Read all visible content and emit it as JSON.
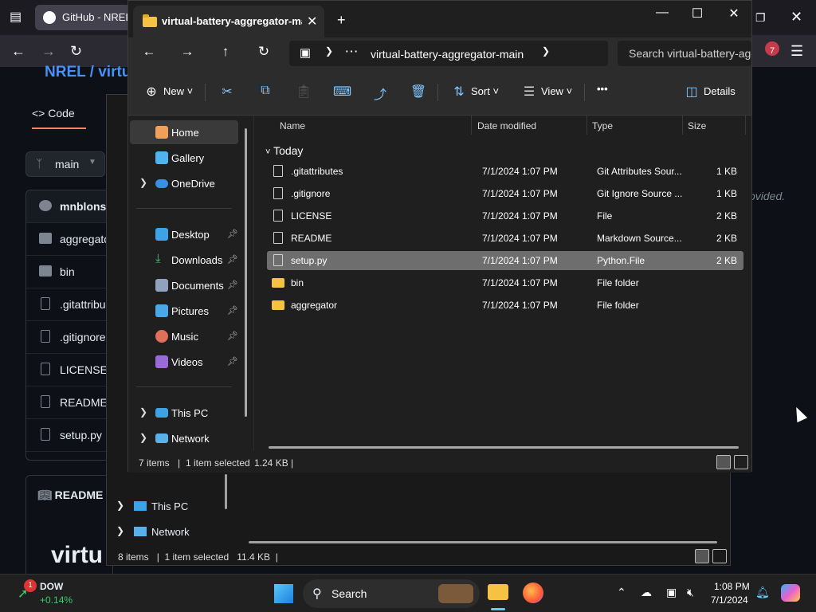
{
  "browser": {
    "tab_title": "GitHub - NREL/",
    "repo_owner": "NREL /",
    "repo_name": "virtu",
    "code_tab": "Code",
    "branch": "main",
    "files": [
      "mnblonsk",
      "aggregato",
      "bin",
      ".gitattribu",
      ".gitignore",
      "LICENSE",
      "README.",
      "setup.py"
    ],
    "readme_tab": "README",
    "readme_title": "virtu",
    "side_text": "ovided."
  },
  "explorer": {
    "tab_title": "virtual-battery-aggregator-main",
    "path": "virtual-battery-aggregator-main",
    "search_placeholder": "Search virtual-battery-aggregator-main",
    "toolbar": {
      "new_label": "New",
      "sort_label": "Sort",
      "view_label": "View",
      "more_label": "•••",
      "details_label": "Details"
    },
    "nav": {
      "home": "Home",
      "gallery": "Gallery",
      "onedrive": "OneDrive",
      "desktop": "Desktop",
      "downloads": "Downloads",
      "documents": "Documents",
      "pictures": "Pictures",
      "music": "Music",
      "videos": "Videos",
      "thispc": "This PC",
      "network": "Network"
    },
    "columns": [
      "Name",
      "Date modified",
      "Type",
      "Size"
    ],
    "group": "Today",
    "rows": [
      {
        "name": ".gitattributes",
        "date": "7/1/2024 1:07 PM",
        "type": "Git Attributes Sour...",
        "size": "1 KB"
      },
      {
        "name": ".gitignore",
        "date": "7/1/2024 1:07 PM",
        "type": "Git Ignore Source ...",
        "size": "1 KB"
      },
      {
        "name": "LICENSE",
        "date": "7/1/2024 1:07 PM",
        "type": "File",
        "size": "2 KB"
      },
      {
        "name": "README",
        "date": "7/1/2024 1:07 PM",
        "type": "Markdown Source...",
        "size": "2 KB"
      },
      {
        "name": "setup.py",
        "date": "7/1/2024 1:07 PM",
        "type": "Python.File",
        "size": "2 KB"
      },
      {
        "name": "bin",
        "date": "7/1/2024 1:07 PM",
        "type": "File folder",
        "size": ""
      },
      {
        "name": "aggregator",
        "date": "7/1/2024 1:07 PM",
        "type": "File folder",
        "size": ""
      }
    ],
    "status": {
      "count": "7 items",
      "selected": "1 item selected",
      "size": "1.24 KB"
    }
  },
  "explorer2": {
    "thispc": "This PC",
    "network": "Network",
    "status": {
      "count": "8 items",
      "selected": "1 item selected",
      "size": "11.4 KB"
    }
  },
  "taskbar": {
    "ticker": "DOW",
    "ticker_change": "+0.14%",
    "notification_count": "1",
    "search_label": "Search",
    "time": "1:08 PM",
    "date": "7/1/2024",
    "browser_badge": "7"
  }
}
